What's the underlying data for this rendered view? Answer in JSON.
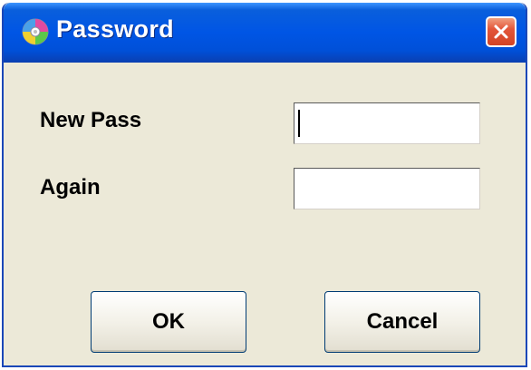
{
  "window": {
    "title": "Password",
    "icon": "cd-disc-icon",
    "close_icon": "close-icon"
  },
  "form": {
    "new_pass_label": "New Pass",
    "new_pass_value": "",
    "again_label": "Again",
    "again_value": ""
  },
  "buttons": {
    "ok_label": "OK",
    "cancel_label": "Cancel"
  },
  "colors": {
    "titlebar": "#0055e5",
    "client_bg": "#ece9d8",
    "close_button": "#e3563a"
  }
}
